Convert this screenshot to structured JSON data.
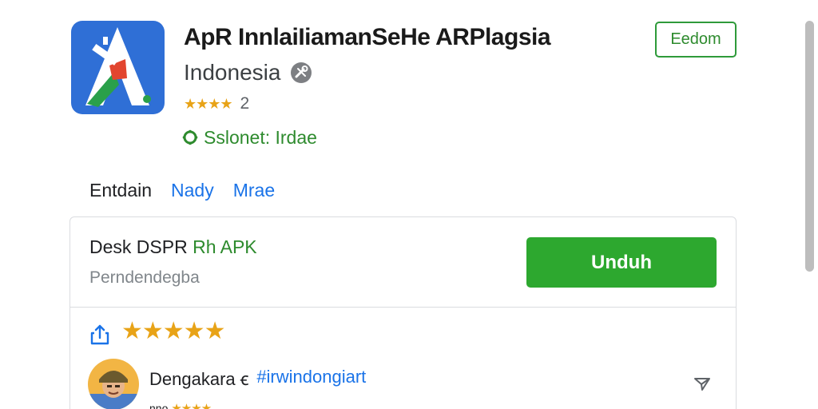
{
  "app": {
    "title": "ApR InnlaiIiamanSeHe ARPlagsia",
    "developer": "Indonesia",
    "rating_count": "2",
    "stars": "★★★★",
    "verified_text": "Sslonet: Irdae",
    "header_button_label": "Eedom",
    "icon_name": "app-logo",
    "developer_badge_icon": "tools-icon"
  },
  "tabs": [
    {
      "label": "Entdain",
      "active": true
    },
    {
      "label": "Nady",
      "active": false
    },
    {
      "label": "Mrae",
      "active": false
    }
  ],
  "download_card": {
    "title_prefix": "Desk DSPR",
    "title_accent": "Rh APK",
    "subtitle": "Perndendegba",
    "download_button_label": "Unduh"
  },
  "review": {
    "stars": "★★★★★",
    "share_icon": "share-icon",
    "reviewer_name": "Dengakara ꞓ",
    "reviewer_tag": "#irwindongiart",
    "reviewer_sub_text": "nno",
    "reviewer_sub_stars": "★★★★",
    "send_icon": "send-icon"
  },
  "colors": {
    "accent_green": "#2da82f",
    "link_blue": "#1a73e8",
    "star_gold": "#e8a317"
  }
}
